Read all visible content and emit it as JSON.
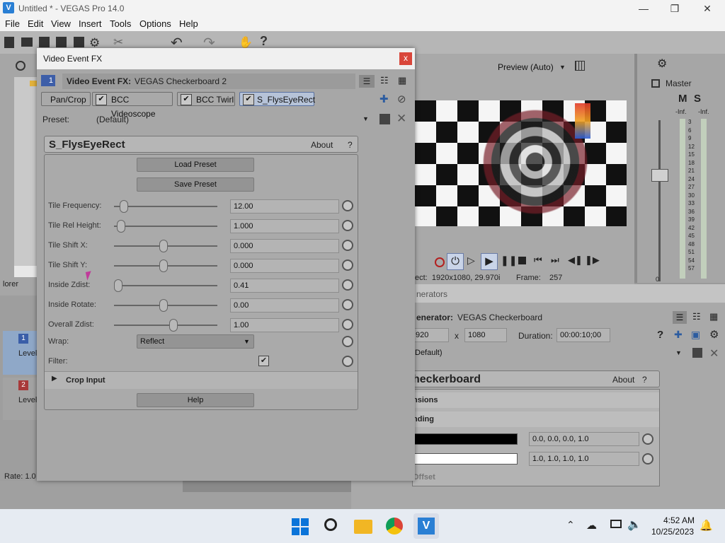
{
  "app": {
    "title": "Untitled * - VEGAS Pro 14.0"
  },
  "menu": [
    "File",
    "Edit",
    "View",
    "Insert",
    "Tools",
    "Options",
    "Help"
  ],
  "fx_dialog": {
    "window_title": "Video Event FX",
    "close": "x",
    "chain_index": "1",
    "chain_label": "Video Event FX:",
    "chain_value": "VEGAS Checkerboard 2",
    "tabs": [
      "Pan/Crop",
      "BCC Videoscope",
      "BCC Twirl",
      "S_FlysEyeRect"
    ],
    "preset_label": "Preset:",
    "preset_value": "(Default)",
    "plugin_name": "S_FlysEyeRect",
    "about": "About",
    "question": "?",
    "load_preset": "Load Preset",
    "save_preset": "Save Preset",
    "params": [
      {
        "label": "Tile Frequency:",
        "value": "12.00",
        "pos": 0.1
      },
      {
        "label": "Tile Rel Height:",
        "value": "1.000",
        "pos": 0.07
      },
      {
        "label": "Tile Shift X:",
        "value": "0.000",
        "pos": 0.5
      },
      {
        "label": "Tile Shift Y:",
        "value": "0.000",
        "pos": 0.5
      },
      {
        "label": "Inside Zdist:",
        "value": "0.41",
        "pos": 0.04
      },
      {
        "label": "Inside Rotate:",
        "value": "0.00",
        "pos": 0.5
      },
      {
        "label": "Overall Zdist:",
        "value": "1.00",
        "pos": 0.6
      }
    ],
    "wrap_label": "Wrap:",
    "wrap_value": "Reflect",
    "filter_label": "Filter:",
    "crop_input": "Crop Input",
    "help": "Help"
  },
  "preview": {
    "mode": "Preview (Auto)",
    "project_info": "ect:  1920x1080, 29.970i",
    "frame_label": "Frame:",
    "frame_value": "257"
  },
  "master": {
    "label": "Master",
    "m": "M",
    "s": "S",
    "inf_left": "-Inf.",
    "inf_right": "-Inf.",
    "scale": [
      "3",
      "6",
      "9",
      "12",
      "15",
      "18",
      "21",
      "24",
      "27",
      "30",
      "33",
      "36",
      "39",
      "42",
      "45",
      "48",
      "51",
      "54",
      "57"
    ],
    "zero": "0"
  },
  "generator": {
    "title": "nerators",
    "gen_label": "enerator:",
    "gen_value": "VEGAS Checkerboard",
    "width": "920",
    "x": "x",
    "height": "1080",
    "duration_label": "Duration:",
    "duration_value": "00:00:10;00",
    "preset_value": "Default)",
    "name": "heckerboard",
    "about": "About",
    "question": "?",
    "section1": "nsions",
    "section2": "nding",
    "color1": "0.0, 0.0, 0.0, 1.0",
    "color2": "1.0, 1.0, 1.0, 1.0",
    "offset": "Offset"
  },
  "timeline": {
    "explorer": "lorer",
    "track1_num": "1",
    "track1_label": "Level",
    "track2_num": "2",
    "track2_label": "Level",
    "rate": "Rate: 1.0"
  },
  "taskbar": {
    "time": "4:52 AM",
    "date": "10/25/2023"
  }
}
